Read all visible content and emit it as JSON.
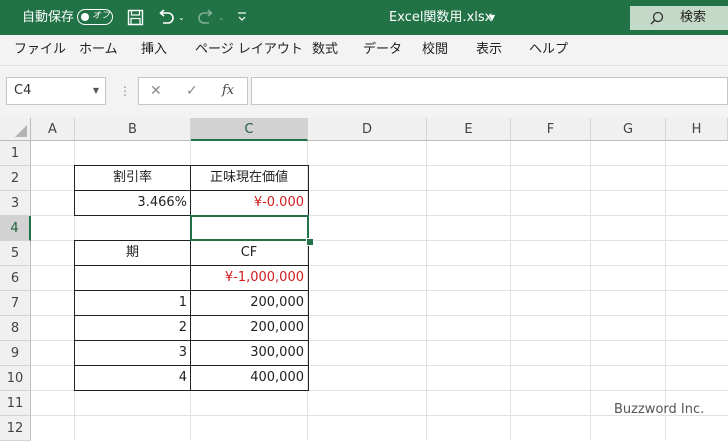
{
  "titlebar": {
    "autosave_label": "自動保存",
    "autosave_state": "オフ",
    "filename": "Excel関数用.xlsx",
    "search_label": "検索",
    "save_icon": "save-icon",
    "undo_icon": "undo-icon",
    "redo_icon": "redo-icon"
  },
  "menu": {
    "items": [
      "ファイル",
      "ホーム",
      "挿入",
      "ページ レイアウト",
      "数式",
      "データ",
      "校閲",
      "表示",
      "ヘルプ"
    ]
  },
  "formula_bar": {
    "name_box": "C4",
    "formula": ""
  },
  "sheet": {
    "columns": [
      "A",
      "B",
      "C",
      "D",
      "E",
      "F",
      "G",
      "H"
    ],
    "rows": [
      "1",
      "2",
      "3",
      "4",
      "5",
      "6",
      "7",
      "8",
      "9",
      "10",
      "11",
      "12"
    ],
    "selected_cell": "C4",
    "cells": {
      "B2": "割引率",
      "C2": "正味現在価値",
      "B3": "3.466%",
      "C3": "¥-0.000",
      "B5": "期",
      "C5": "CF",
      "C6": "¥-1,000,000",
      "B7": "1",
      "C7": "200,000",
      "B8": "2",
      "C8": "200,000",
      "B9": "3",
      "C9": "300,000",
      "B10": "4",
      "C10": "400,000"
    }
  },
  "colors": {
    "accent": "#217346",
    "negative": "#d01e1e"
  },
  "watermark": "Buzzword Inc."
}
